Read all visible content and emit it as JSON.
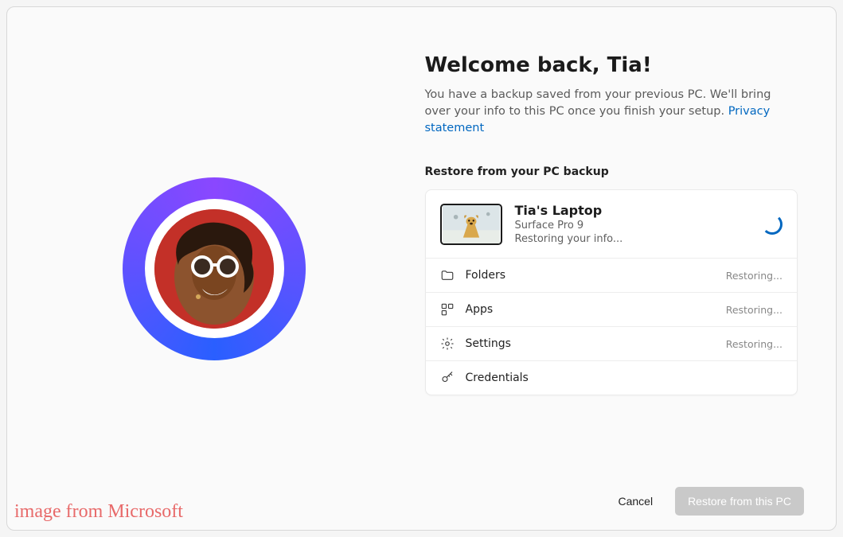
{
  "heading": "Welcome back, Tia!",
  "subtext": "You have a backup saved from your previous PC. We'll bring over your info to this PC once you finish your setup. ",
  "privacy_link": "Privacy statement",
  "section_label": "Restore from your PC backup",
  "device": {
    "name": "Tia's Laptop",
    "model": "Surface Pro 9",
    "status": "Restoring your info..."
  },
  "items": [
    {
      "icon": "folder-icon",
      "label": "Folders",
      "status": "Restoring..."
    },
    {
      "icon": "apps-icon",
      "label": "Apps",
      "status": "Restoring..."
    },
    {
      "icon": "settings-icon",
      "label": "Settings",
      "status": "Restoring..."
    },
    {
      "icon": "key-icon",
      "label": "Credentials",
      "status": ""
    }
  ],
  "buttons": {
    "cancel": "Cancel",
    "restore": "Restore from this PC"
  },
  "watermark": "image from Microsoft"
}
